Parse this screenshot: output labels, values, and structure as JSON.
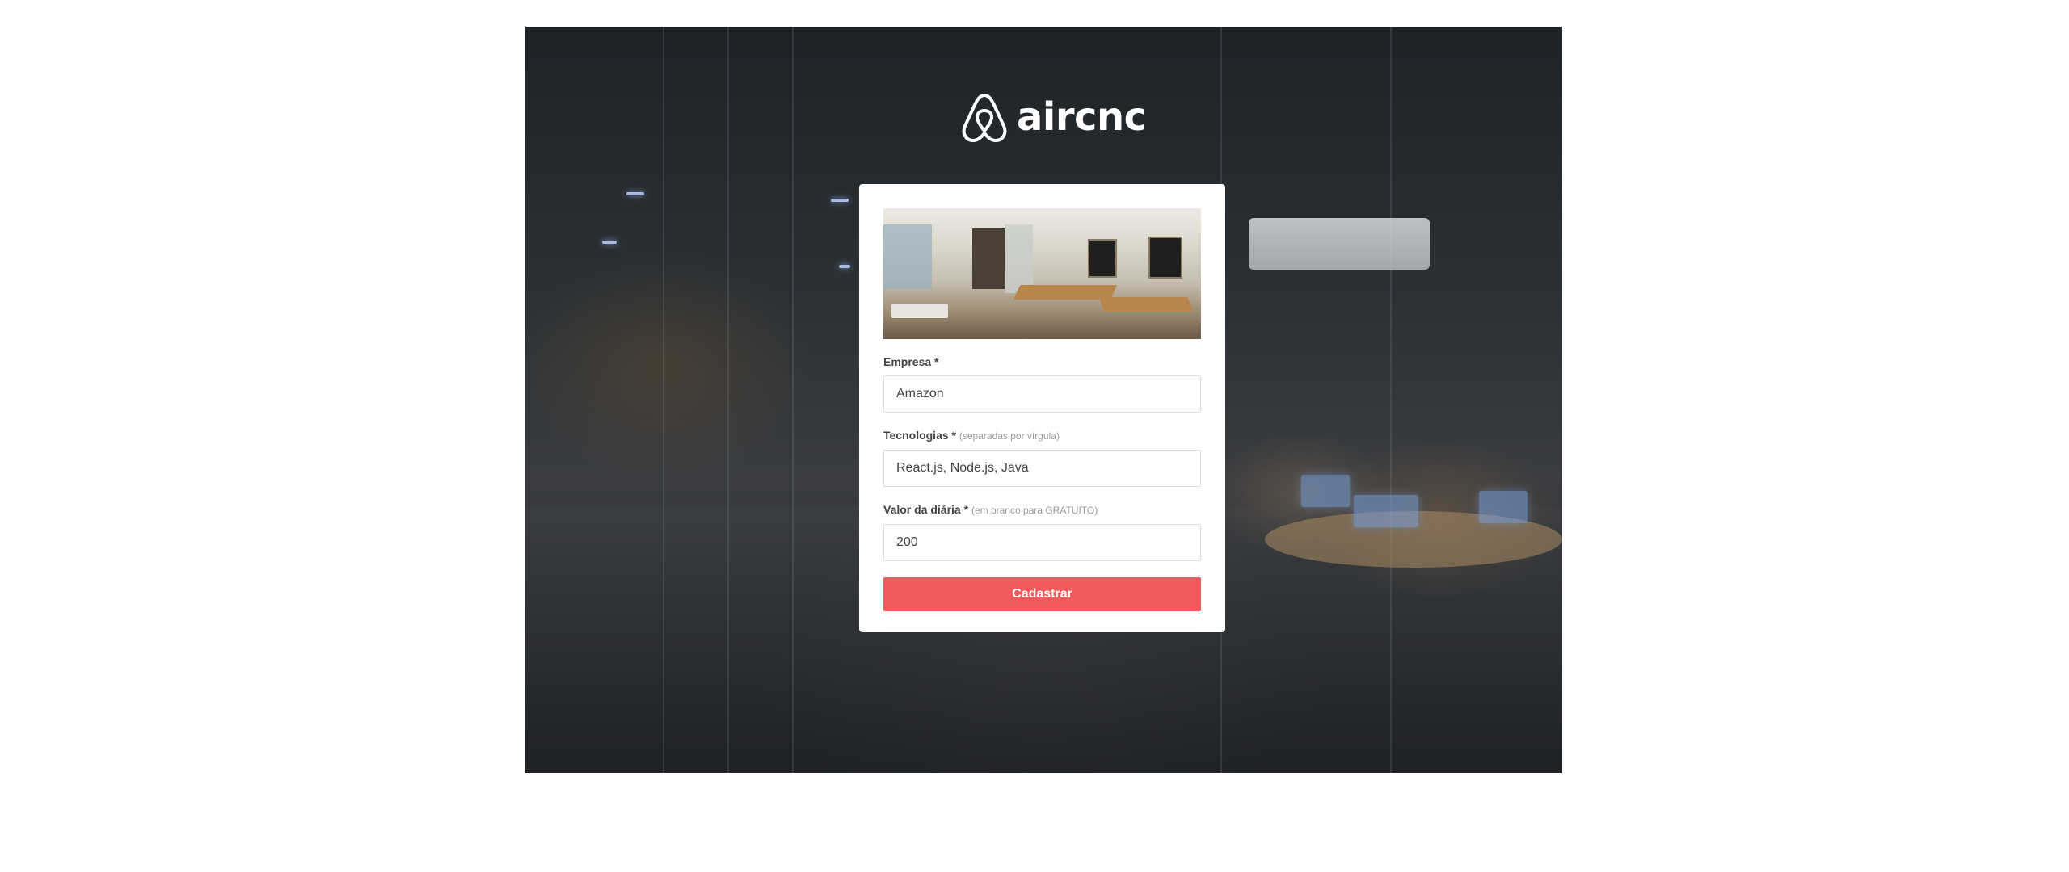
{
  "app": {
    "logo_text": "aircnc",
    "logo_icon": "airbnb-belo-icon"
  },
  "form": {
    "company": {
      "label": "Empresa *",
      "value": "Amazon"
    },
    "techs": {
      "label": "Tecnologias *",
      "hint": "(separadas por vírgula)",
      "value": "React.js, Node.js, Java"
    },
    "price": {
      "label": "Valor da diária *",
      "hint": "(em branco para GRATUITO)",
      "value": "200"
    },
    "submit_label": "Cadastrar"
  },
  "colors": {
    "accent": "#f05a5b",
    "label": "#444444",
    "hint": "#999999",
    "card": "#ffffff"
  }
}
